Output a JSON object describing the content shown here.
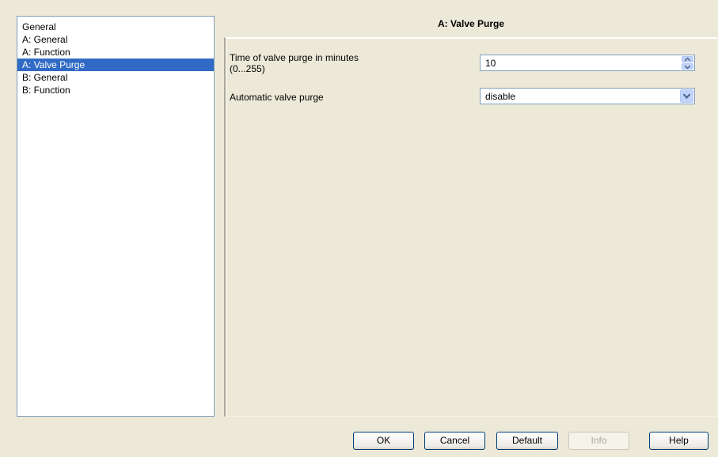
{
  "tree": {
    "items": [
      {
        "label": "General",
        "selected": false
      },
      {
        "label": "A: General",
        "selected": false
      },
      {
        "label": "A: Function",
        "selected": false
      },
      {
        "label": "A: Valve Purge",
        "selected": true
      },
      {
        "label": "B: General",
        "selected": false
      },
      {
        "label": "B: Function",
        "selected": false
      }
    ]
  },
  "panel": {
    "title": "A: Valve Purge",
    "params": [
      {
        "label_line1": "Time of valve purge in minutes",
        "label_line2": "(0...255)",
        "value": "10",
        "control": "spinner"
      },
      {
        "label": "Automatic valve purge",
        "value": "disable",
        "control": "dropdown"
      }
    ]
  },
  "buttons": {
    "ok": "OK",
    "cancel": "Cancel",
    "default": "Default",
    "info": "Info",
    "help": "Help"
  },
  "colors": {
    "background": "#ece9d8",
    "selection": "#316ac5",
    "field_border": "#7f9db9"
  },
  "icons": {
    "spin_up": "spin-up-arrow-icon",
    "spin_down": "spin-down-arrow-icon",
    "dropdown": "chevron-down-icon"
  }
}
